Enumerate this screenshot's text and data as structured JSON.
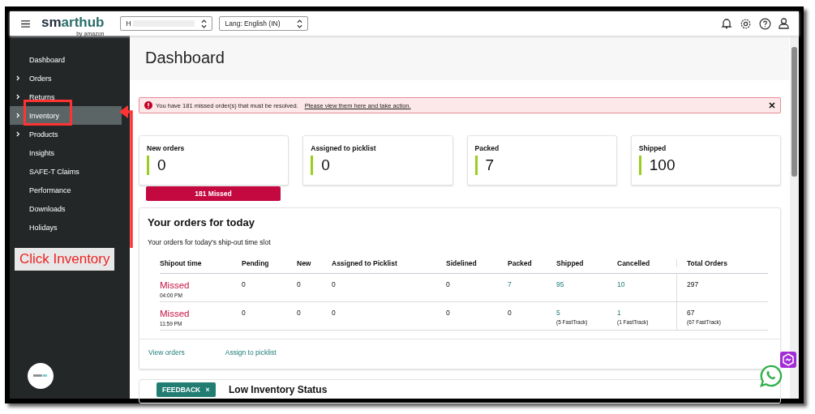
{
  "header": {
    "logo": {
      "primary": "sm",
      "secondary": "arthub",
      "tagline": "by amazon"
    },
    "store_select": {
      "value": "H"
    },
    "lang_select": {
      "value": "Lang: English (IN)"
    }
  },
  "sidebar": {
    "items": [
      {
        "label": "Dashboard",
        "expandable": false,
        "selected": false
      },
      {
        "label": "Orders",
        "expandable": true,
        "selected": false
      },
      {
        "label": "Returns",
        "expandable": true,
        "selected": false
      },
      {
        "label": "Inventory",
        "expandable": true,
        "selected": true
      },
      {
        "label": "Products",
        "expandable": true,
        "selected": false
      },
      {
        "label": "Insights",
        "expandable": false,
        "selected": false
      },
      {
        "label": "SAFE-T Claims",
        "expandable": false,
        "selected": false
      },
      {
        "label": "Performance",
        "expandable": false,
        "selected": false
      },
      {
        "label": "Downloads",
        "expandable": false,
        "selected": false
      },
      {
        "label": "Holidays",
        "expandable": false,
        "selected": false
      }
    ]
  },
  "page_title": "Dashboard",
  "alert": {
    "message": "You have 181 missed order(s) that must be resolved.",
    "link": "Please view them here and take action."
  },
  "stats": [
    {
      "label": "New orders",
      "value": "0",
      "missed": "181 Missed"
    },
    {
      "label": "Assigned to picklist",
      "value": "0"
    },
    {
      "label": "Packed",
      "value": "7"
    },
    {
      "label": "Shipped",
      "value": "100"
    }
  ],
  "orders_card": {
    "title": "Your orders for today",
    "subtitle": "Your orders for today's ship-out time slot",
    "columns": [
      "Shipout time",
      "Pending",
      "New",
      "Assigned to Picklist",
      "Sidelined",
      "Packed",
      "Shipped",
      "Cancelled",
      "Total Orders"
    ],
    "rows": [
      [
        {
          "kind": "status",
          "text": "Missed",
          "sub": "04:00 PM"
        },
        {
          "kind": "plain",
          "text": "0"
        },
        {
          "kind": "plain",
          "text": "0"
        },
        {
          "kind": "plain",
          "text": "0"
        },
        {
          "kind": "plain",
          "text": "0"
        },
        {
          "kind": "link",
          "text": "7"
        },
        {
          "kind": "link",
          "text": "95"
        },
        {
          "kind": "link",
          "text": "10"
        },
        {
          "kind": "plain",
          "text": "297"
        }
      ],
      [
        {
          "kind": "status",
          "text": "Missed",
          "sub": "11:59 PM"
        },
        {
          "kind": "plain",
          "text": "0"
        },
        {
          "kind": "plain",
          "text": "0"
        },
        {
          "kind": "plain",
          "text": "0"
        },
        {
          "kind": "plain",
          "text": "0"
        },
        {
          "kind": "plain",
          "text": "0"
        },
        {
          "kind": "link",
          "text": "5",
          "sub": "(5 FastTrack)"
        },
        {
          "kind": "link",
          "text": "1",
          "sub": "(1 FastTrack)"
        },
        {
          "kind": "plain",
          "text": "67",
          "sub": "(67 FastTrack)"
        }
      ]
    ],
    "links": [
      "View orders",
      "Assign to picklist"
    ]
  },
  "next_card": {
    "title": "Low Inventory Status"
  },
  "feedback": {
    "label": "FEEDBACK",
    "close": "×"
  },
  "annotation": {
    "label": "Click Inventory"
  }
}
